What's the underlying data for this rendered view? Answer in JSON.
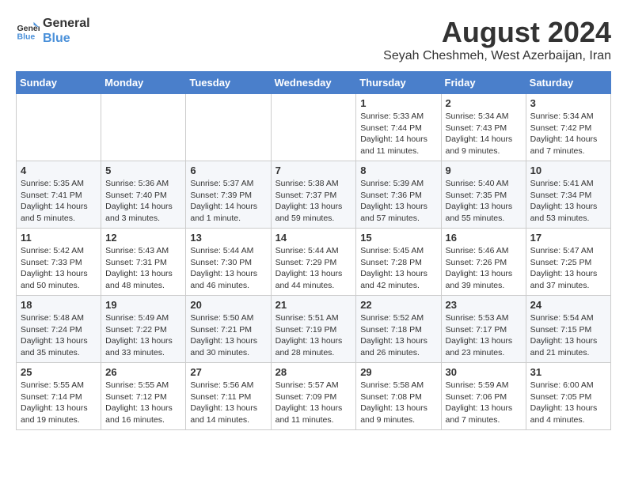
{
  "header": {
    "logo_line1": "General",
    "logo_line2": "Blue",
    "month_year": "August 2024",
    "location": "Seyah Cheshmeh, West Azerbaijan, Iran"
  },
  "days_of_week": [
    "Sunday",
    "Monday",
    "Tuesday",
    "Wednesday",
    "Thursday",
    "Friday",
    "Saturday"
  ],
  "weeks": [
    [
      {
        "day": "",
        "info": ""
      },
      {
        "day": "",
        "info": ""
      },
      {
        "day": "",
        "info": ""
      },
      {
        "day": "",
        "info": ""
      },
      {
        "day": "1",
        "info": "Sunrise: 5:33 AM\nSunset: 7:44 PM\nDaylight: 14 hours\nand 11 minutes."
      },
      {
        "day": "2",
        "info": "Sunrise: 5:34 AM\nSunset: 7:43 PM\nDaylight: 14 hours\nand 9 minutes."
      },
      {
        "day": "3",
        "info": "Sunrise: 5:34 AM\nSunset: 7:42 PM\nDaylight: 14 hours\nand 7 minutes."
      }
    ],
    [
      {
        "day": "4",
        "info": "Sunrise: 5:35 AM\nSunset: 7:41 PM\nDaylight: 14 hours\nand 5 minutes."
      },
      {
        "day": "5",
        "info": "Sunrise: 5:36 AM\nSunset: 7:40 PM\nDaylight: 14 hours\nand 3 minutes."
      },
      {
        "day": "6",
        "info": "Sunrise: 5:37 AM\nSunset: 7:39 PM\nDaylight: 14 hours\nand 1 minute."
      },
      {
        "day": "7",
        "info": "Sunrise: 5:38 AM\nSunset: 7:37 PM\nDaylight: 13 hours\nand 59 minutes."
      },
      {
        "day": "8",
        "info": "Sunrise: 5:39 AM\nSunset: 7:36 PM\nDaylight: 13 hours\nand 57 minutes."
      },
      {
        "day": "9",
        "info": "Sunrise: 5:40 AM\nSunset: 7:35 PM\nDaylight: 13 hours\nand 55 minutes."
      },
      {
        "day": "10",
        "info": "Sunrise: 5:41 AM\nSunset: 7:34 PM\nDaylight: 13 hours\nand 53 minutes."
      }
    ],
    [
      {
        "day": "11",
        "info": "Sunrise: 5:42 AM\nSunset: 7:33 PM\nDaylight: 13 hours\nand 50 minutes."
      },
      {
        "day": "12",
        "info": "Sunrise: 5:43 AM\nSunset: 7:31 PM\nDaylight: 13 hours\nand 48 minutes."
      },
      {
        "day": "13",
        "info": "Sunrise: 5:44 AM\nSunset: 7:30 PM\nDaylight: 13 hours\nand 46 minutes."
      },
      {
        "day": "14",
        "info": "Sunrise: 5:44 AM\nSunset: 7:29 PM\nDaylight: 13 hours\nand 44 minutes."
      },
      {
        "day": "15",
        "info": "Sunrise: 5:45 AM\nSunset: 7:28 PM\nDaylight: 13 hours\nand 42 minutes."
      },
      {
        "day": "16",
        "info": "Sunrise: 5:46 AM\nSunset: 7:26 PM\nDaylight: 13 hours\nand 39 minutes."
      },
      {
        "day": "17",
        "info": "Sunrise: 5:47 AM\nSunset: 7:25 PM\nDaylight: 13 hours\nand 37 minutes."
      }
    ],
    [
      {
        "day": "18",
        "info": "Sunrise: 5:48 AM\nSunset: 7:24 PM\nDaylight: 13 hours\nand 35 minutes."
      },
      {
        "day": "19",
        "info": "Sunrise: 5:49 AM\nSunset: 7:22 PM\nDaylight: 13 hours\nand 33 minutes."
      },
      {
        "day": "20",
        "info": "Sunrise: 5:50 AM\nSunset: 7:21 PM\nDaylight: 13 hours\nand 30 minutes."
      },
      {
        "day": "21",
        "info": "Sunrise: 5:51 AM\nSunset: 7:19 PM\nDaylight: 13 hours\nand 28 minutes."
      },
      {
        "day": "22",
        "info": "Sunrise: 5:52 AM\nSunset: 7:18 PM\nDaylight: 13 hours\nand 26 minutes."
      },
      {
        "day": "23",
        "info": "Sunrise: 5:53 AM\nSunset: 7:17 PM\nDaylight: 13 hours\nand 23 minutes."
      },
      {
        "day": "24",
        "info": "Sunrise: 5:54 AM\nSunset: 7:15 PM\nDaylight: 13 hours\nand 21 minutes."
      }
    ],
    [
      {
        "day": "25",
        "info": "Sunrise: 5:55 AM\nSunset: 7:14 PM\nDaylight: 13 hours\nand 19 minutes."
      },
      {
        "day": "26",
        "info": "Sunrise: 5:55 AM\nSunset: 7:12 PM\nDaylight: 13 hours\nand 16 minutes."
      },
      {
        "day": "27",
        "info": "Sunrise: 5:56 AM\nSunset: 7:11 PM\nDaylight: 13 hours\nand 14 minutes."
      },
      {
        "day": "28",
        "info": "Sunrise: 5:57 AM\nSunset: 7:09 PM\nDaylight: 13 hours\nand 11 minutes."
      },
      {
        "day": "29",
        "info": "Sunrise: 5:58 AM\nSunset: 7:08 PM\nDaylight: 13 hours\nand 9 minutes."
      },
      {
        "day": "30",
        "info": "Sunrise: 5:59 AM\nSunset: 7:06 PM\nDaylight: 13 hours\nand 7 minutes."
      },
      {
        "day": "31",
        "info": "Sunrise: 6:00 AM\nSunset: 7:05 PM\nDaylight: 13 hours\nand 4 minutes."
      }
    ]
  ]
}
